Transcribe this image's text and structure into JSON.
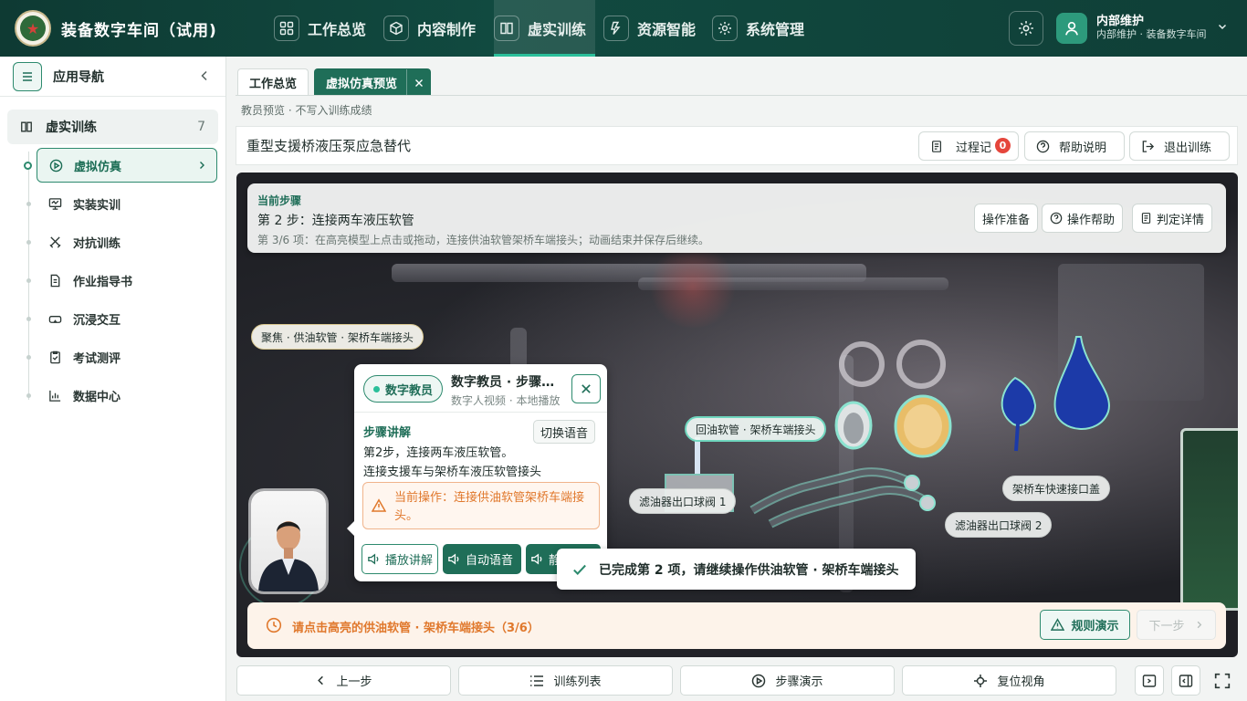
{
  "app": {
    "title": "装备数字车间（试用)",
    "accent": "#1f6e58",
    "topbar_color": "#114a40",
    "warning_color": "#e0782c",
    "danger_color": "#e5463c"
  },
  "topnav": [
    {
      "label": "工作总览",
      "icon": "grid-icon"
    },
    {
      "label": "内容制作",
      "icon": "cube-icon"
    },
    {
      "label": "虚实训练",
      "icon": "book-icon",
      "active": true
    },
    {
      "label": "资源智能",
      "icon": "lightning-icon"
    },
    {
      "label": "系统管理",
      "icon": "gear-icon"
    }
  ],
  "user": {
    "name": "内部维护",
    "subtitle": "内部维护 · 装备数字车间"
  },
  "sidebar": {
    "title": "应用导航",
    "group": {
      "label": "虚实训练",
      "count": "7"
    },
    "items": [
      {
        "label": "虚拟仿真",
        "icon": "play-circle-icon",
        "active": true
      },
      {
        "label": "实装实训",
        "icon": "monitor-icon"
      },
      {
        "label": "对抗训练",
        "icon": "swords-icon"
      },
      {
        "label": "作业指导书",
        "icon": "document-icon"
      },
      {
        "label": "沉浸交互",
        "icon": "vr-goggles-icon"
      },
      {
        "label": "考试测评",
        "icon": "exam-icon"
      },
      {
        "label": "数据中心",
        "icon": "chart-icon"
      }
    ]
  },
  "tabs": [
    {
      "label": "工作总览"
    },
    {
      "label": "虚拟仿真预览",
      "active": true
    }
  ],
  "preview_note": "教员预览 · 不写入训练成绩",
  "scene": {
    "title": "重型支援桥液压泵应急替代",
    "toolbar": {
      "process_label": "过程记",
      "process_badge": "0",
      "help_label": "帮助说明",
      "exit_label": "退出训练"
    }
  },
  "step": {
    "label": "当前步骤",
    "title": "第 2 步：连接两车液压软管",
    "desc": "第 3/6 项：在高亮模型上点击或拖动，连接供油软管架桥车端接头；动画结束并保存后继续。",
    "buttons": [
      "操作准备",
      "操作帮助",
      "判定详情"
    ]
  },
  "labels": {
    "focus": "聚焦 · 供油软管 · 架桥车端接头",
    "return_hose": "回油软管 · 架桥车端接头",
    "filter_valve_1": "滤油器出口球阀 1",
    "filter_valve_2": "滤油器出口球阀 2",
    "quick_cap": "架桥车快速接口盖"
  },
  "tutor": {
    "badge": "数字教员",
    "name": "数字教员 · 步骤讲解",
    "subtitle": "数字人视频 · 本地播放",
    "section": "步骤讲解",
    "switch_voice": "切换语音",
    "line1": "第2步，连接两车液压软管。",
    "line2": "连接支援车与架桥车液压软管接头",
    "current_op": "当前操作：连接供油软管架桥车端接头。",
    "btn_play": "播放讲解",
    "btn_auto": "自动语音",
    "btn_third": "静音"
  },
  "toast": "已完成第 2 项，请继续操作供油软管 · 架桥车端接头",
  "hint": {
    "text": "请点击高亮的供油软管 · 架桥车端接头（3/6）",
    "rule_demo": "规则演示",
    "next": "下一步"
  },
  "bottom": {
    "prev": "上一步",
    "list": "训练列表",
    "demo": "步骤演示",
    "reset": "复位视角"
  }
}
